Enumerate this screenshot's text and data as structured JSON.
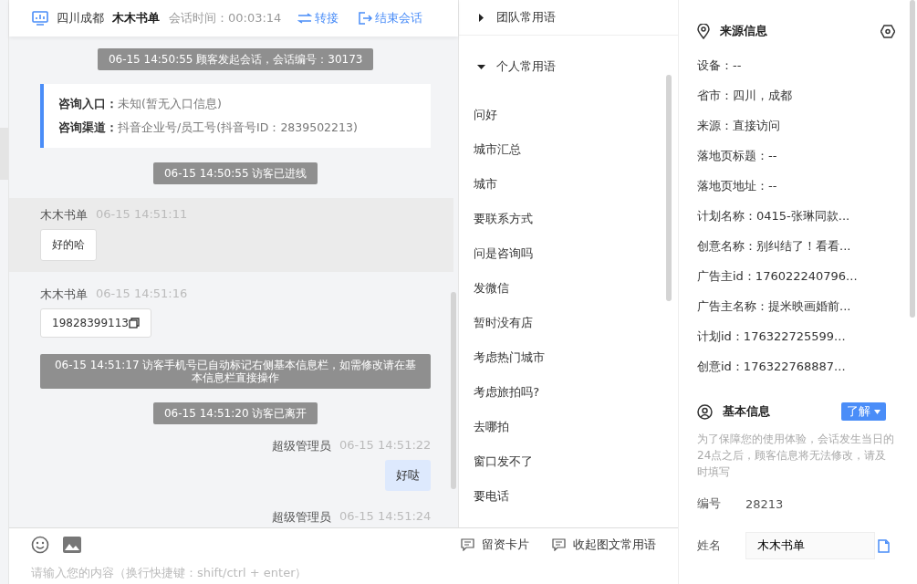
{
  "header": {
    "location": "四川成都",
    "visitor": "木木书单",
    "duration": "会话时间：00:03:14",
    "actions": [
      {
        "kind": "transfer",
        "label": "转接"
      },
      {
        "kind": "end",
        "label": "结束会话"
      }
    ]
  },
  "messages": [
    {
      "kind": "system",
      "text": "06-15 14:50:55 顾客发起会话，会话编号：30173"
    },
    {
      "kind": "entry",
      "lines": [
        {
          "label": "咨询入口：",
          "value": "未知(暂无入口信息)"
        },
        {
          "label": "咨询渠道：",
          "value": "抖音企业号/员工号(抖音号ID：2839502213)"
        }
      ]
    },
    {
      "kind": "system",
      "text": "06-15 14:50:55 访客已进线"
    },
    {
      "kind": "visitor",
      "sender": "木木书单",
      "time": "06-15 14:51:11",
      "text": "好的哈",
      "selected": true,
      "copy": false
    },
    {
      "kind": "visitor",
      "sender": "木木书单",
      "time": "06-15 14:51:16",
      "text": "19828399113",
      "selected": false,
      "copy": true
    },
    {
      "kind": "system",
      "text": "06-15 14:51:17 访客手机号已自动标记右侧基本信息栏，如需修改请在基本信息栏直接操作"
    },
    {
      "kind": "system",
      "text": "06-15 14:51:20 访客已离开"
    },
    {
      "kind": "agent",
      "sender": "超级管理员",
      "time": "06-15 14:51:22",
      "text": "好哒"
    },
    {
      "kind": "agent",
      "sender": "超级管理员",
      "time": "06-15 14:51:24"
    }
  ],
  "phrase_groups": [
    {
      "title": "团队常用语",
      "expanded": false
    },
    {
      "title": "个人常用语",
      "expanded": true,
      "items": [
        "问好",
        "城市汇总",
        "城市",
        "要联系方式",
        "问是咨询吗",
        "发微信",
        "暂时没有店",
        "考虑热门城市",
        "考虑旅拍吗?",
        "去哪拍",
        "窗口发不了",
        "要电话"
      ]
    }
  ],
  "composer": {
    "placeholder": "请输入您的内容（换行快捷键：shift/ctrl + enter）",
    "actions": [
      "留资卡片",
      "收起图文常用语"
    ]
  },
  "source_info": {
    "title": "来源信息",
    "rows": [
      "设备：--",
      "省市：四川，成都",
      "来源：直接访问",
      "落地页标题：--",
      "落地页地址：--",
      "计划名称：0415-张琳同款...",
      "创意名称：别纠结了！看看...",
      "广告主id：176022240796...",
      "广告主名称：提米映画婚前...",
      "计划id：176322725599...",
      "创意id：176322768887..."
    ]
  },
  "basic_info": {
    "title": "基本信息",
    "button": "了解",
    "notice": "为了保障您的使用体验，会话发生当日的24点之后，顾客信息将无法修改，请及时填写",
    "fields": [
      {
        "kind": "text",
        "label": "编号",
        "value": "28213"
      },
      {
        "kind": "input",
        "label": "姓名",
        "value": "木木书单"
      }
    ]
  }
}
